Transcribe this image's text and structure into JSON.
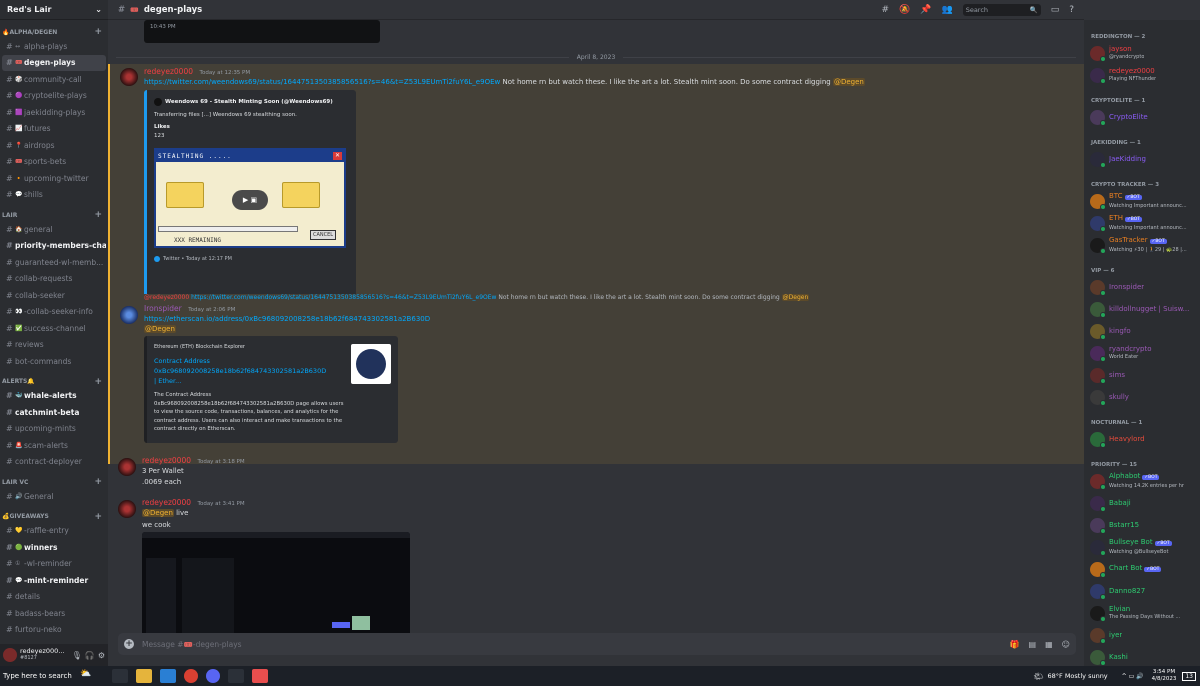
{
  "server": {
    "name": "Red's Lair"
  },
  "channel": {
    "name": "degen-plays",
    "placeholder": "Message #🎟️-degen-plays"
  },
  "search": {
    "placeholder": "Search"
  },
  "sidebar": {
    "sections": [
      {
        "category": "🔥ALPHA/DEGEN",
        "channels": [
          {
            "emoji": "↔",
            "name": "alpha-plays",
            "state": "normal"
          },
          {
            "emoji": "🎟️",
            "name": "degen-plays",
            "state": "active"
          },
          {
            "emoji": "🎲",
            "name": "community-call",
            "state": "normal"
          },
          {
            "emoji": "🟣",
            "name": "cryptoelite-plays",
            "state": "normal"
          },
          {
            "emoji": "🟪",
            "name": "jaekidding-plays",
            "state": "normal"
          },
          {
            "emoji": "📈",
            "name": "futures",
            "state": "normal"
          },
          {
            "emoji": "📍",
            "name": "airdrops",
            "state": "normal"
          },
          {
            "emoji": "🎟️",
            "name": "sports-bets",
            "state": "normal"
          },
          {
            "emoji": "🔸",
            "name": "upcoming-twitter",
            "state": "normal"
          },
          {
            "emoji": "💬",
            "name": "shills",
            "state": "normal"
          }
        ]
      },
      {
        "category": "LAIR",
        "channels": [
          {
            "emoji": "🏠",
            "name": "general",
            "state": "normal"
          },
          {
            "emoji": "",
            "name": "priority-members-chat",
            "state": "unread"
          },
          {
            "emoji": "",
            "name": "guaranteed-wl-memb...",
            "state": "normal"
          },
          {
            "emoji": "",
            "name": "collab-requests",
            "state": "normal"
          },
          {
            "emoji": "",
            "name": "collab-seeker",
            "state": "normal"
          },
          {
            "emoji": "👀",
            "name": "-collab-seeker-info",
            "state": "normal"
          },
          {
            "emoji": "✅",
            "name": "success-channel",
            "state": "normal"
          },
          {
            "emoji": "",
            "name": "reviews",
            "state": "normal"
          },
          {
            "emoji": "",
            "name": "bot-commands",
            "state": "normal"
          }
        ]
      },
      {
        "category": "ALERTS🔔",
        "channels": [
          {
            "emoji": "🐳",
            "name": "whale-alerts",
            "state": "unread"
          },
          {
            "emoji": "",
            "name": "catchmint-beta",
            "state": "unread"
          },
          {
            "emoji": "",
            "name": "upcoming-mints",
            "state": "normal"
          },
          {
            "emoji": "🚨",
            "name": "scam-alerts",
            "state": "normal"
          },
          {
            "emoji": "",
            "name": "contract-deployer",
            "state": "normal"
          }
        ]
      },
      {
        "category": "LAIR VC",
        "channels": [
          {
            "emoji": "🔊",
            "name": "General",
            "state": "normal"
          }
        ]
      },
      {
        "category": "💰GIVEAWAYS",
        "channels": [
          {
            "emoji": "💛",
            "name": "-raffle-entry",
            "state": "normal"
          },
          {
            "emoji": "🟢",
            "name": "winners",
            "state": "unread"
          },
          {
            "emoji": "①",
            "name": "-wl-reminder",
            "state": "normal"
          },
          {
            "emoji": "💬",
            "name": "-mint-reminder",
            "state": "unread"
          },
          {
            "emoji": "",
            "name": "details",
            "state": "normal"
          },
          {
            "emoji": "",
            "name": "badass-bears",
            "state": "normal"
          },
          {
            "emoji": "",
            "name": "furtoru-neko",
            "state": "normal"
          }
        ]
      }
    ]
  },
  "user": {
    "name": "redeyez000...",
    "tag": "#8127"
  },
  "messages": {
    "prev_time": "10:43 PM",
    "date": "April 8, 2023",
    "m1": {
      "author": "redeyez0000",
      "time": "Today at 12:35 PM",
      "link": "https://twitter.com/weendows69/status/1644751350385856516?s=46&t=Z53L9EUmTi2fuY6L_e9OEw",
      "text": " Not home rn but watch these. I like the art a lot. Stealth mint soon. Do some contract digging ",
      "mention": "@Degen",
      "embed": {
        "title": "Weendows 69 - Stealth Minting Soon (@Weendows69)",
        "desc": "Transferring files [...] Weendows 69 stealthing soon.",
        "likes_label": "Likes",
        "likes": "123",
        "win_title": "STEALTHING .....",
        "remaining": "XXX REMAINING",
        "cancel": "CANCEL",
        "footer": "Twitter • Today at 12:17 PM"
      }
    },
    "m2": {
      "reply_author": "@redeyez0000",
      "reply_link": "https://twitter.com/weendows69/status/1644751350385856516?s=46&t=Z53L9EUmTi2fuY6L_e9OEw",
      "reply_text": " Not home rn but watch these. I like the art a lot. Stealth mint soon. Do some contract digging ",
      "reply_mention": "@Degen",
      "author": "Ironspider",
      "time": "Today at 2:06 PM",
      "link": "https://etherscan.io/address/0xBc968092008258e18b62f684743302581a2B630D",
      "mention": "@Degen",
      "embed": {
        "provider": "Ethereum (ETH) Blockchain Explorer",
        "title": "Contract Address 0xBc968092008258e18b62f684743302581a2B630D | Ether...",
        "desc": "The Contract Address 0xBc968092008258e18b62f684743302581a2B630D page allows users to view the source code, transactions, balances, and analytics for the contract address. Users can also interact and make transactions to the contract directly on Etherscan."
      }
    },
    "m3": {
      "author": "redeyez0000",
      "time": "Today at 3:18 PM",
      "line1": "3 Per Wallet",
      "line2": ".0069 each"
    },
    "m4": {
      "author": "redeyez0000",
      "time": "Today at 3:41 PM",
      "mention": "@Degen",
      "text": " live",
      "line2": "we cook"
    }
  },
  "members": [
    {
      "category": "REDDINGTON — 2",
      "items": [
        {
          "name": "jayson",
          "status": "@ryandcrypto",
          "color": "#f23f43",
          "bot": false
        },
        {
          "name": "redeyez0000",
          "status": "Playing NFThunder",
          "color": "#f23f43",
          "bot": false
        }
      ]
    },
    {
      "category": "CRYPTOELITE — 1",
      "items": [
        {
          "name": "CryptoElite",
          "status": "",
          "color": "#8a5cf5",
          "bot": false
        }
      ]
    },
    {
      "category": "JAEKIDDING — 1",
      "items": [
        {
          "name": "JaeKidding",
          "status": "",
          "color": "#8a5cf5",
          "bot": false
        }
      ]
    },
    {
      "category": "CRYPTO TRACKER — 3",
      "items": [
        {
          "name": "BTC",
          "status": "Watching Important announc...",
          "color": "#e67e22",
          "bot": true
        },
        {
          "name": "ETH",
          "status": "Watching Important announc...",
          "color": "#e67e22",
          "bot": true
        },
        {
          "name": "GasTracker",
          "status": "Watching ⚡30 | 🚶29 | 🐢28 |...",
          "color": "#e67e22",
          "bot": true
        }
      ]
    },
    {
      "category": "VIP — 6",
      "items": [
        {
          "name": "Ironspider",
          "status": "",
          "color": "#9b59b6",
          "bot": false
        },
        {
          "name": "killdollnugget | Suisw...",
          "status": "",
          "color": "#9b59b6",
          "bot": false
        },
        {
          "name": "kingfo",
          "status": "",
          "color": "#9b59b6",
          "bot": false
        },
        {
          "name": "ryandcrypto",
          "status": "World Eater",
          "color": "#9b59b6",
          "bot": false
        },
        {
          "name": "sims",
          "status": "",
          "color": "#9b59b6",
          "bot": false
        },
        {
          "name": "skully",
          "status": "",
          "color": "#9b59b6",
          "bot": false
        }
      ]
    },
    {
      "category": "NOCTURNAL — 1",
      "items": [
        {
          "name": "Heavylord",
          "status": "",
          "color": "#e74c3c",
          "bot": false
        }
      ]
    },
    {
      "category": "PRIORITY — 15",
      "items": [
        {
          "name": "Alphabot",
          "status": "Watching 14.2K entries per hr",
          "color": "#2ecc71",
          "bot": true
        },
        {
          "name": "Babaji",
          "status": "",
          "color": "#2ecc71",
          "bot": false
        },
        {
          "name": "Bstarr15",
          "status": "",
          "color": "#2ecc71",
          "bot": false
        },
        {
          "name": "Bullseye Bot",
          "status": "Watching @BullseyeBot",
          "color": "#2ecc71",
          "bot": true
        },
        {
          "name": "Chart Bot",
          "status": "",
          "color": "#2ecc71",
          "bot": true
        },
        {
          "name": "Danno827",
          "status": "",
          "color": "#2ecc71",
          "bot": false
        },
        {
          "name": "Elvian",
          "status": "The Passing Days Without ...",
          "color": "#2ecc71",
          "bot": false
        },
        {
          "name": "iyer",
          "status": "",
          "color": "#2ecc71",
          "bot": false
        },
        {
          "name": "Kashi",
          "status": "",
          "color": "#2ecc71",
          "bot": false
        }
      ]
    }
  ],
  "taskbar": {
    "search": "Type here to search",
    "weather": "68°F  Mostly sunny",
    "time": "3:54 PM",
    "date": "4/8/2023",
    "notif": "13"
  }
}
